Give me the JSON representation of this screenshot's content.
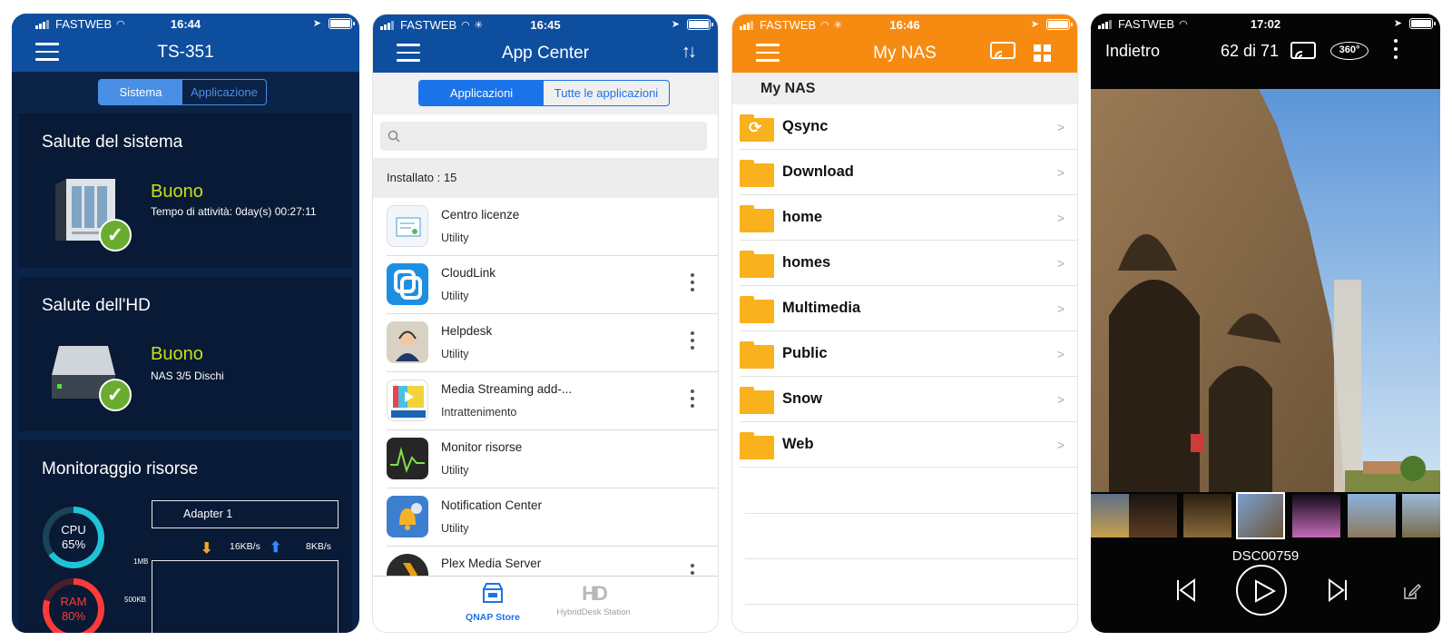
{
  "status": {
    "carrier": "FASTWEB",
    "times": [
      "16:44",
      "16:45",
      "16:46",
      "17:02"
    ]
  },
  "panel1": {
    "title": "TS-351",
    "tabs": [
      "Sistema",
      "Applicazione"
    ],
    "system_health": {
      "title": "Salute del sistema",
      "status": "Buono",
      "uptime": "Tempo di attività: 0day(s)  00:27:11"
    },
    "hd_health": {
      "title": "Salute dell'HD",
      "status": "Buono",
      "disks": "NAS 3/5 Dischi"
    },
    "monitor": {
      "title": "Monitoraggio risorse",
      "cpu_label": "CPU",
      "cpu_value": "65%",
      "cpu_pct": 65,
      "ram_label": "RAM",
      "ram_value": "80%",
      "ram_pct": 80,
      "adapter": "Adapter 1",
      "download_speed": "16KB/s",
      "upload_speed": "8KB/s",
      "axis_top": "1MB",
      "axis_mid": "500KB"
    }
  },
  "panel2": {
    "title": "App Center",
    "tabs": [
      "Applicazioni",
      "Tutte le applicazioni"
    ],
    "search_placeholder": "",
    "installed": "Installato : 15",
    "apps": [
      {
        "name": "Centro licenze",
        "category": "Utility",
        "icon": "license-center-icon"
      },
      {
        "name": "CloudLink",
        "category": "Utility",
        "icon": "cloudlink-icon"
      },
      {
        "name": "Helpdesk",
        "category": "Utility",
        "icon": "helpdesk-icon"
      },
      {
        "name": "Media Streaming add-...",
        "category": "Intrattenimento",
        "icon": "media-streaming-icon"
      },
      {
        "name": "Monitor risorse",
        "category": "Utility",
        "icon": "resource-monitor-icon"
      },
      {
        "name": "Notification Center",
        "category": "Utility",
        "icon": "notification-center-icon"
      },
      {
        "name": "Plex Media Server",
        "category": "",
        "icon": "plex-icon"
      }
    ],
    "bottom_tabs": [
      "QNAP Store",
      "HybridDesk Station"
    ]
  },
  "panel3": {
    "title": "My NAS",
    "header": "My NAS",
    "folders": [
      "Qsync",
      "Download",
      "home",
      "homes",
      "Multimedia",
      "Public",
      "Snow",
      "Web"
    ]
  },
  "panel4": {
    "back": "Indietro",
    "counter": "62 di 71",
    "badge_360": "360°",
    "filename": "DSC00759"
  },
  "colors": {
    "qnap_blue": "#0e4e9f",
    "orange": "#f78b12",
    "dark_navy": "#0b2346",
    "good_yellow": "#c8df1a"
  }
}
